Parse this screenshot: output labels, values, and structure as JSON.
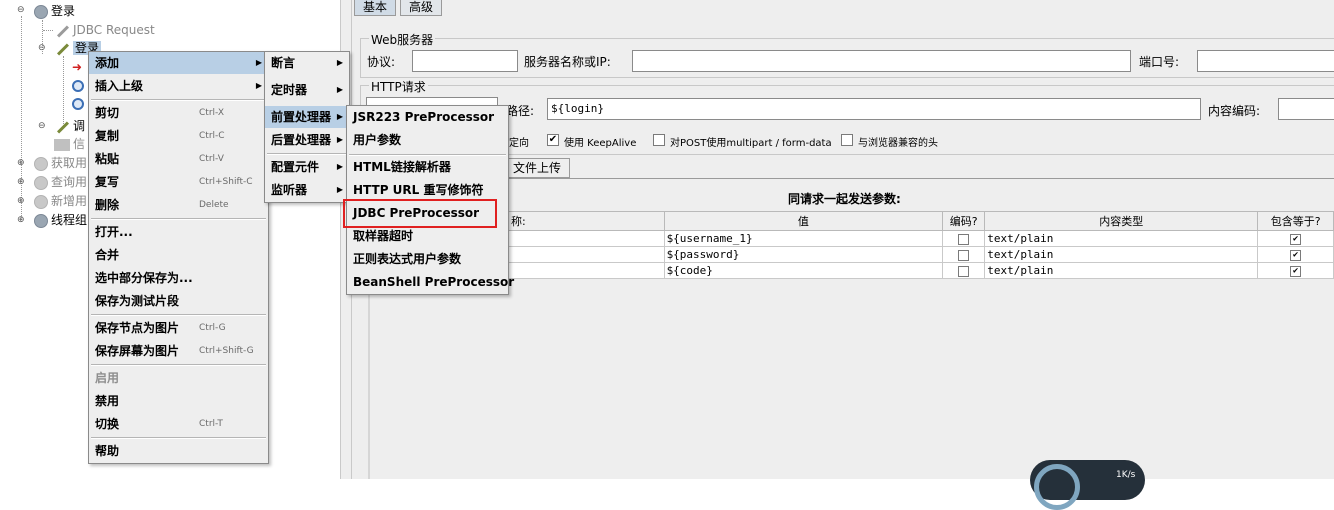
{
  "tree": {
    "items": [
      {
        "label": "登录"
      },
      {
        "label": "JDBC Request"
      },
      {
        "label": "登录"
      },
      {
        "label": "调"
      },
      {
        "label": "信"
      },
      {
        "label": "获取用"
      },
      {
        "label": "查询用"
      },
      {
        "label": "新增用"
      },
      {
        "label": "线程组"
      }
    ]
  },
  "tabs": {
    "basic": "基本",
    "advanced": "高级"
  },
  "web_server": {
    "title": "Web服务器",
    "protocol_label": "协议:",
    "protocol_value": "",
    "server_label": "服务器名称或IP:",
    "server_value": "",
    "port_label": "端口号:",
    "port_value": ""
  },
  "http_request": {
    "title": "HTTP请求",
    "path_label": "路径:",
    "path_value": "${login}",
    "encoding_label": "内容编码:",
    "encoding_value": ""
  },
  "options": {
    "redirect_partial": "定向",
    "keepalive": "使用 KeepAlive",
    "multipart": "对POST使用multipart / form-data",
    "browser_headers": "与浏览器兼容的头"
  },
  "subtabs": {
    "upload": "文件上传"
  },
  "params": {
    "title": "同请求一起发送参数:",
    "headers": [
      "称:",
      "值",
      "编码?",
      "内容类型",
      "包含等于?"
    ],
    "rows": [
      {
        "name": "",
        "value": "${username_1}",
        "encode": false,
        "type": "text/plain",
        "include": true
      },
      {
        "name": "",
        "value": "${password}",
        "encode": false,
        "type": "text/plain",
        "include": true
      },
      {
        "name": "",
        "value": "${code}",
        "encode": false,
        "type": "text/plain",
        "include": true
      }
    ]
  },
  "menu1": {
    "items": [
      {
        "label": "添加",
        "shortcut": ""
      },
      {
        "label": "插入上级",
        "shortcut": ""
      },
      {
        "label": "剪切",
        "shortcut": "Ctrl-X"
      },
      {
        "label": "复制",
        "shortcut": "Ctrl-C"
      },
      {
        "label": "粘贴",
        "shortcut": "Ctrl-V"
      },
      {
        "label": "复写",
        "shortcut": "Ctrl+Shift-C"
      },
      {
        "label": "删除",
        "shortcut": "Delete"
      },
      {
        "label": "打开...",
        "shortcut": ""
      },
      {
        "label": "合并",
        "shortcut": ""
      },
      {
        "label": "选中部分保存为...",
        "shortcut": ""
      },
      {
        "label": "保存为测试片段",
        "shortcut": ""
      },
      {
        "label": "保存节点为图片",
        "shortcut": "Ctrl-G"
      },
      {
        "label": "保存屏幕为图片",
        "shortcut": "Ctrl+Shift-G"
      },
      {
        "label": "启用",
        "shortcut": ""
      },
      {
        "label": "禁用",
        "shortcut": ""
      },
      {
        "label": "切换",
        "shortcut": "Ctrl-T"
      },
      {
        "label": "帮助",
        "shortcut": ""
      }
    ]
  },
  "menu2": {
    "items": [
      {
        "label": "断言"
      },
      {
        "label": "定时器"
      },
      {
        "label": "前置处理器"
      },
      {
        "label": "后置处理器"
      },
      {
        "label": "配置元件"
      },
      {
        "label": "监听器"
      }
    ]
  },
  "menu3": {
    "items": [
      {
        "label": "JSR223 PreProcessor"
      },
      {
        "label": "用户参数"
      },
      {
        "label": "HTML链接解析器"
      },
      {
        "label": "HTTP URL 重写修饰符"
      },
      {
        "label": "JDBC PreProcessor"
      },
      {
        "label": "取样器超时"
      },
      {
        "label": "正则表达式用户参数"
      },
      {
        "label": "BeanShell PreProcessor"
      }
    ]
  },
  "badge": {
    "text": "1K/s"
  },
  "colors": {
    "highlight": "#b8cfe5",
    "callout": "#e02020",
    "menu_bg": "#eeeeee"
  }
}
